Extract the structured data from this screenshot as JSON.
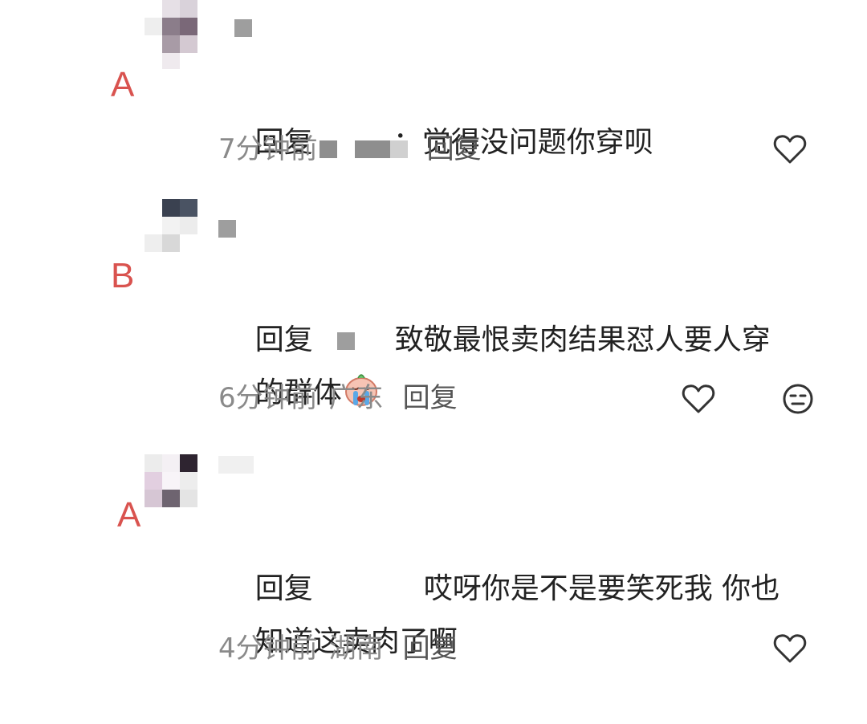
{
  "comments": [
    {
      "marker": "A",
      "reply_prefix": "回复",
      "text": "：觉得没问题你穿呗",
      "time": "7分钟前",
      "location": "",
      "reply_label": "回复",
      "has_dislike": false
    },
    {
      "marker": "B",
      "reply_prefix": "回复",
      "text_line1": "致敬最恨卖肉结果怼人要人穿",
      "text_line2": "的群体",
      "time": "6分钟前",
      "location": "广东",
      "reply_label": "回复",
      "has_dislike": true,
      "emoji": "crying-face-emoji"
    },
    {
      "marker": "A",
      "reply_prefix": "回复",
      "text_line1": "哎呀你是不是要笑死我 你也",
      "text_line2": "知道这卖肉了啊",
      "time": "4分钟前",
      "location": "湖南",
      "reply_label": "回复",
      "has_dislike": false
    }
  ],
  "icons": {
    "like": "heart-outline-icon",
    "dislike": "neutral-face-icon"
  },
  "colors": {
    "marker": "#d9534f",
    "meta_text": "#8a8a8a",
    "body_text": "#222222"
  }
}
